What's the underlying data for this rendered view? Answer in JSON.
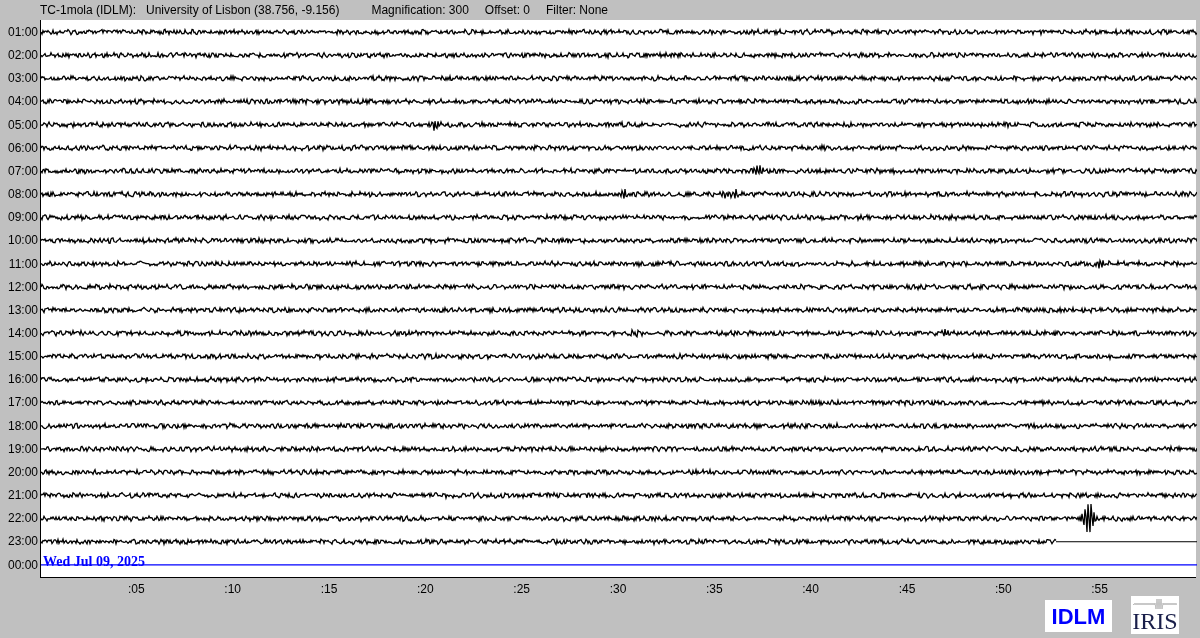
{
  "header": {
    "station": "TC-1mola (IDLM):",
    "location": "University of Lisbon (38.756, -9.156)",
    "magnification": "Magnification: 300",
    "offset": "Offset: 0",
    "filter": "Filter: None"
  },
  "helicorder": {
    "rows": [
      {
        "label": "01:00",
        "kind": "trace"
      },
      {
        "label": "02:00",
        "kind": "trace"
      },
      {
        "label": "03:00",
        "kind": "trace"
      },
      {
        "label": "04:00",
        "kind": "trace"
      },
      {
        "label": "05:00",
        "kind": "trace"
      },
      {
        "label": "06:00",
        "kind": "trace"
      },
      {
        "label": "07:00",
        "kind": "trace"
      },
      {
        "label": "08:00",
        "kind": "trace"
      },
      {
        "label": "09:00",
        "kind": "trace"
      },
      {
        "label": "10:00",
        "kind": "trace"
      },
      {
        "label": "11:00",
        "kind": "trace"
      },
      {
        "label": "12:00",
        "kind": "trace"
      },
      {
        "label": "13:00",
        "kind": "trace"
      },
      {
        "label": "14:00",
        "kind": "trace"
      },
      {
        "label": "15:00",
        "kind": "trace"
      },
      {
        "label": "16:00",
        "kind": "trace"
      },
      {
        "label": "17:00",
        "kind": "trace"
      },
      {
        "label": "18:00",
        "kind": "trace"
      },
      {
        "label": "19:00",
        "kind": "trace"
      },
      {
        "label": "20:00",
        "kind": "trace"
      },
      {
        "label": "21:00",
        "kind": "trace"
      },
      {
        "label": "22:00",
        "kind": "trace"
      },
      {
        "label": "23:00",
        "kind": "partial"
      },
      {
        "label": "00:00",
        "kind": "current"
      }
    ],
    "date": "Wed Jul 09, 2025",
    "x_ticks": [
      ":05",
      ":10",
      ":15",
      ":20",
      ":25",
      ":30",
      ":35",
      ":40",
      ":45",
      ":50",
      ":55"
    ]
  },
  "logos": {
    "station": "IDLM",
    "network": "IRIS"
  }
}
